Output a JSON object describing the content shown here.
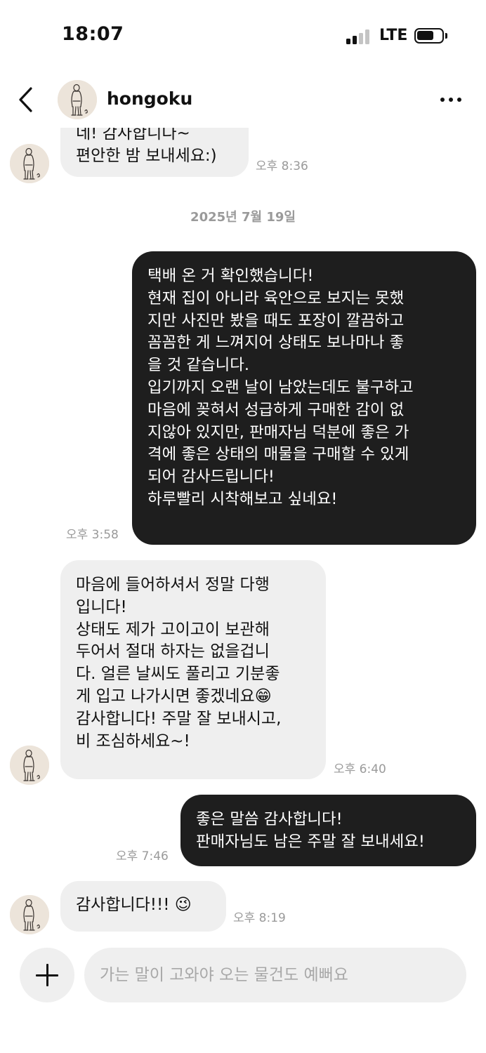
{
  "status_bar": {
    "time": "18:07",
    "network": "LTE",
    "signal_bars": 2,
    "battery_level": 0.7
  },
  "header": {
    "username": "hongoku",
    "avatar": "person-figure-avatar"
  },
  "messages": [
    {
      "side": "in",
      "text": "네! 감사합니다~\n편안한 밤 보내세요:)",
      "time": "오후 8:36"
    },
    {
      "date_separator": "2025년 7월 19일"
    },
    {
      "side": "out",
      "text": "택배 온 거 확인했습니다!\n현재 집이 아니라 육안으로 보지는 못했\n지만 사진만 봤을 때도 포장이 깔끔하고\n꼼꼼한 게 느껴지어 상태도 보나마나 좋\n을 것 같습니다.\n입기까지 오랜 날이 남았는데도 불구하고\n마음에 꽂혀서 성급하게 구매한 감이 없\n지않아 있지만, 판매자님 덕분에 좋은 가\n격에 좋은 상태의 매물을 구매할 수 있게\n되어 감사드립니다!\n하루빨리 시착해보고 싶네요!",
      "time": "오후 3:58"
    },
    {
      "side": "in",
      "text": "마음에 들어하셔서 정말 다행\n입니다!\n상태도 제가 고이고이 보관해\n두어서 절대 하자는 없을겁니\n다. 얼른 날씨도 풀리고 기분좋\n게 입고 나가시면 좋겠네요😁\n감사합니다! 주말 잘 보내시고,\n비 조심하세요~!",
      "time": "오후 6:40"
    },
    {
      "side": "out",
      "text": "좋은 말씀 감사합니다!\n판매자님도 남은 주말 잘 보내세요!",
      "time": "오후 7:46"
    },
    {
      "side": "in",
      "text": "감사합니다!!! 😉",
      "time": "오후 8:19"
    }
  ],
  "composer": {
    "placeholder": "가는 말이 고와야 오는 물건도 예뻐요"
  },
  "colors": {
    "incoming_bubble": "#efefef",
    "outgoing_bubble": "#1e1e1e",
    "timestamp": "#9a9a9a"
  }
}
